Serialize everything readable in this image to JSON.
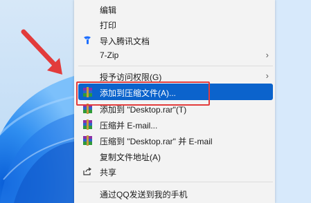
{
  "menu": {
    "items": [
      {
        "label": "编辑",
        "icon": "none"
      },
      {
        "label": "打印",
        "icon": "none"
      },
      {
        "label": "导入腾讯文档",
        "icon": "tencent-docs-icon"
      },
      {
        "label": "7-Zip",
        "icon": "none",
        "submenu": true
      },
      {
        "label": "授予访问权限(G)",
        "icon": "none",
        "submenu": true
      },
      {
        "label": "添加到压缩文件(A)...",
        "icon": "winrar-icon",
        "selected": true
      },
      {
        "label": "添加到 \"Desktop.rar\"(T)",
        "icon": "winrar-icon"
      },
      {
        "label": "压缩并 E-mail...",
        "icon": "winrar-icon"
      },
      {
        "label": "压缩到 \"Desktop.rar\" 并 E-mail",
        "icon": "winrar-icon"
      },
      {
        "label": "复制文件地址(A)",
        "icon": "none"
      },
      {
        "label": "共享",
        "icon": "share-icon"
      },
      {
        "label": "通过QQ发送到我的手机",
        "icon": "none"
      }
    ],
    "submenu_glyph": "›"
  },
  "colors": {
    "menu_bg": "#f3f3f3",
    "selected_bg": "#0b63cc",
    "annotation_red": "#e23b3b",
    "wallpaper_blue": "#2b7fe0"
  }
}
